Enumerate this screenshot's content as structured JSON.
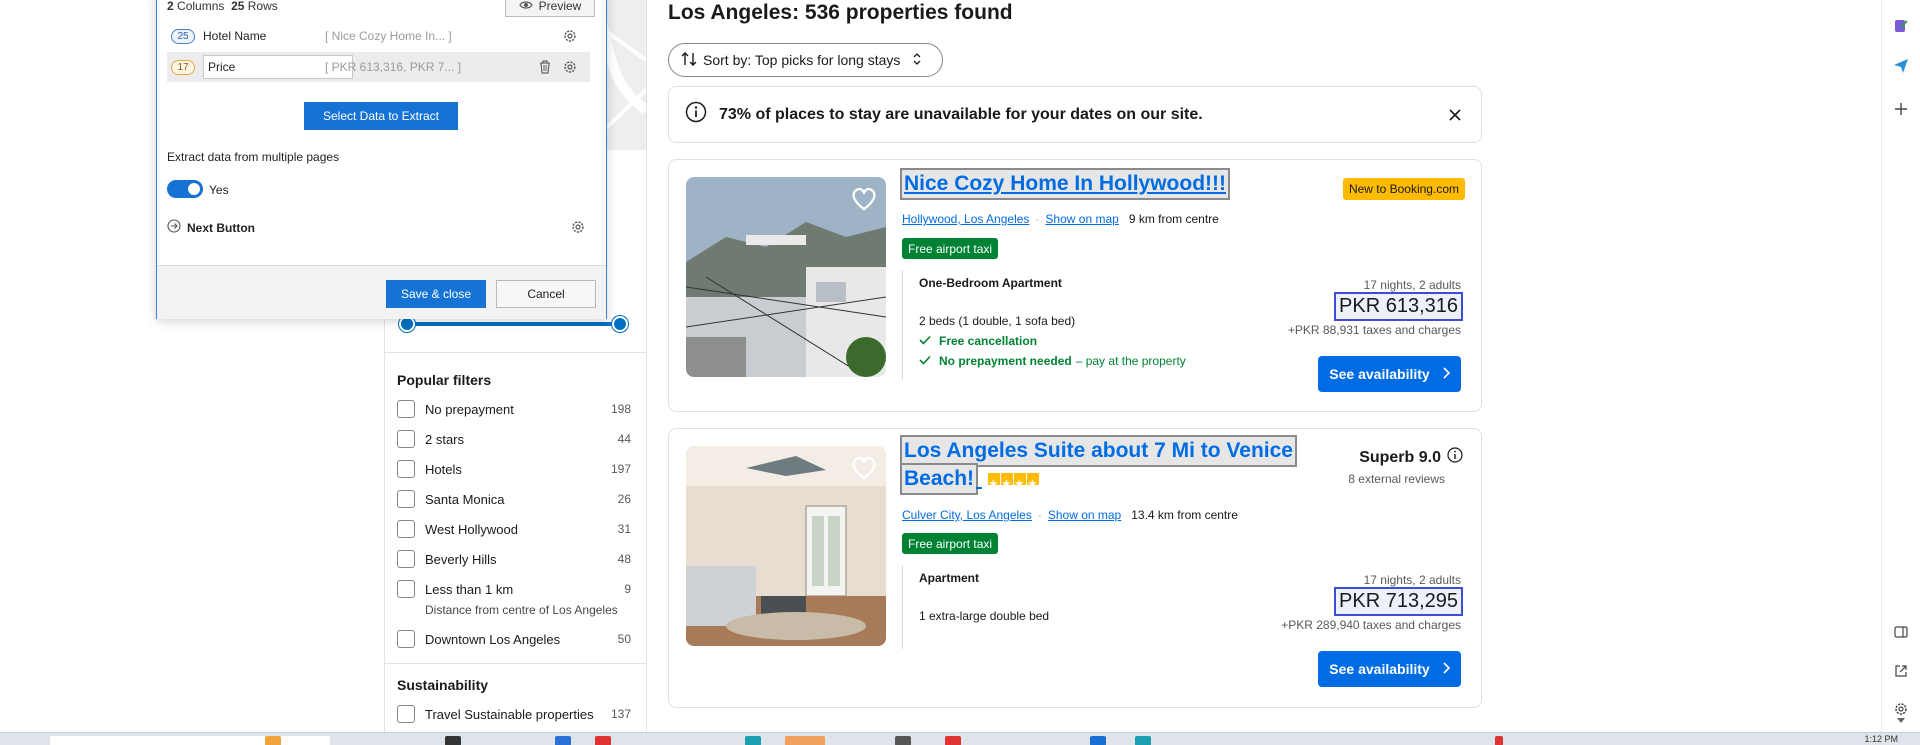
{
  "dialog": {
    "columns_count": "2",
    "columns_label": "Columns",
    "rows_count": "25",
    "rows_label": "Rows",
    "preview_label": "Preview",
    "columns": [
      {
        "count": "25",
        "name": "Hotel Name",
        "sample": "[ Nice Cozy Home In... ]"
      },
      {
        "count": "17",
        "name": "Price",
        "sample": "[ PKR 613,316, PKR 7... ]"
      }
    ],
    "select_button": "Select Data to Extract",
    "multi_page_label": "Extract data from multiple pages",
    "toggle_label": "Yes",
    "next_button_label": "Next Button",
    "save_label": "Save & close",
    "cancel_label": "Cancel"
  },
  "results": {
    "title": "Los Angeles: 536 properties found",
    "sort_label": "Sort by: Top picks for long stays",
    "notice": "73% of places to stay are unavailable for your dates on our site."
  },
  "filters": {
    "popular_heading": "Popular filters",
    "items": [
      {
        "label": "No prepayment",
        "count": "198"
      },
      {
        "label": "2 stars",
        "count": "44"
      },
      {
        "label": "Hotels",
        "count": "197"
      },
      {
        "label": "Santa Monica",
        "count": "26"
      },
      {
        "label": "West Hollywood",
        "count": "31"
      },
      {
        "label": "Beverly Hills",
        "count": "48"
      },
      {
        "label": "Less than 1 km",
        "count": "9",
        "sub": "Distance from centre of Los Angeles"
      },
      {
        "label": "Downtown Los Angeles",
        "count": "50"
      }
    ],
    "sustainability_heading": "Sustainability",
    "sustainability_items": [
      {
        "label": "Travel Sustainable properties",
        "count": "137"
      }
    ]
  },
  "properties": [
    {
      "name": "Nice Cozy Home In Hollywood!!!",
      "stars": 0,
      "location": "Hollywood, Los Angeles",
      "map_link": "Show on map",
      "distance": "9 km from centre",
      "taxi": "Free airport taxi",
      "badge": "New to Booking.com",
      "room_type": "One-Bedroom Apartment",
      "beds": "2 beds (1 double, 1 sofa bed)",
      "perk1": "Free cancellation",
      "perk2_bold": "No prepayment needed",
      "perk2_rest": "– pay at the property",
      "stay": "17 nights, 2 adults",
      "price": "PKR 613,316",
      "taxes": "+PKR 88,931 taxes and charges",
      "button": "See availability"
    },
    {
      "name_line1": "Los Angeles Suite about 7 Mi to Venice",
      "name_line2": "Beach!",
      "stars": 4,
      "location": "Culver City, Los Angeles",
      "map_link": "Show on map",
      "distance": "13.4 km from centre",
      "taxi": "Free airport taxi",
      "score_label": "Superb 9.0",
      "reviews": "8 external reviews",
      "room_type": "Apartment",
      "beds": "1 extra-large double bed",
      "stay": "17 nights, 2 adults",
      "price": "PKR 713,295",
      "taxes": "+PKR 289,940 taxes and charges",
      "button": "See availability"
    }
  ],
  "taskbar": {
    "clock": "1:12 PM"
  },
  "colors": {
    "brand_blue": "#006ce4",
    "dialog_blue": "#1673d6",
    "green": "#008234",
    "yellow": "#febb02"
  }
}
